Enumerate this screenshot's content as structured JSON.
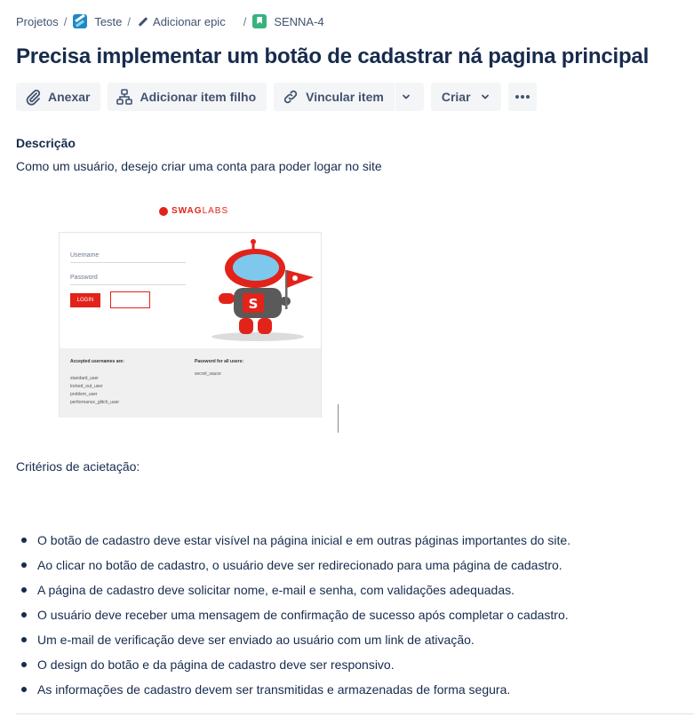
{
  "breadcrumb": {
    "projects": "Projetos",
    "team": "Teste",
    "add_epic": "Adicionar epic",
    "issue_key": "SENNA-4",
    "separator": "/"
  },
  "issue": {
    "title": "Precisa implementar um botão de cadastrar ná pagina principal"
  },
  "toolbar": {
    "attach": "Anexar",
    "add_child": "Adicionar item filho",
    "link": "Vincular item",
    "create": "Criar"
  },
  "description": {
    "label": "Descrição",
    "text": "Como um usuário, desejo criar uma conta para poder logar no site"
  },
  "screenshot": {
    "logo_bold": "SWAG",
    "logo_light": "LABS",
    "username_placeholder": "Username",
    "password_placeholder": "Password",
    "login_button": "LOGIN",
    "accepted_heading": "Accepted usernames are:",
    "usernames": [
      "standard_user",
      "locked_out_user",
      "problem_user",
      "performance_glitch_user"
    ],
    "password_heading": "Password for all users:",
    "password_value": "secret_sauce",
    "accent_color": "#e2231a"
  },
  "criteria": {
    "label": "Critérios de acietação:",
    "items": [
      "O botão de cadastro deve estar visível na página inicial e em outras páginas importantes do site.",
      "Ao clicar no botão de cadastro, o usuário deve ser redirecionado para uma página de cadastro.",
      "A página de cadastro deve solicitar nome, e-mail e senha, com validações adequadas.",
      "O usuário deve receber uma mensagem de confirmação de sucesso após completar o cadastro.",
      "Um e-mail de verificação deve ser enviado ao usuário com um link de ativação.",
      "O design do botão e da página de cadastro deve ser responsivo.",
      "As informações de cadastro devem ser transmitidas e armazenadas de forma segura."
    ]
  },
  "icons": {
    "attach": "paperclip-icon",
    "add_child": "hierarchy-icon",
    "link": "link-icon",
    "create_dropdown": "chevron-down-icon",
    "more": "more-icon",
    "team": "team-icon",
    "epic": "pencil-icon",
    "issue_type": "story-icon"
  }
}
